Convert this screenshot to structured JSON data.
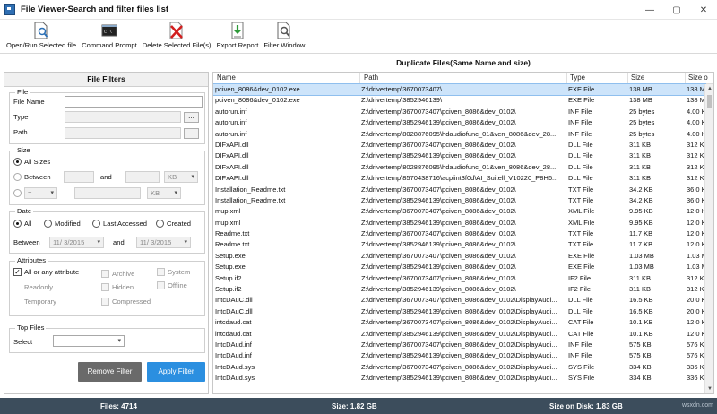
{
  "window": {
    "title": "File Viewer-Search and filter files list",
    "controls": [
      "—",
      "▢",
      "✕"
    ]
  },
  "toolbar": {
    "items": [
      {
        "label": "Open/Run Selected file",
        "icon": "open-file-icon"
      },
      {
        "label": "Command Prompt",
        "icon": "command-prompt-icon"
      },
      {
        "label": "Delete Selected File(s)",
        "icon": "delete-icon"
      },
      {
        "label": "Export Report",
        "icon": "export-icon"
      },
      {
        "label": "Filter Window",
        "icon": "filter-icon"
      }
    ]
  },
  "filters": {
    "header": "File Filters",
    "file": {
      "group_title": "File",
      "file_name_label": "File Name",
      "type_label": "Type",
      "path_label": "Path",
      "browse": "..."
    },
    "size": {
      "group_title": "Size",
      "all_sizes": "All Sizes",
      "between": "Between",
      "and": "and",
      "unit1": "KB",
      "operator": "=",
      "unit2": "KB"
    },
    "date": {
      "group_title": "Date",
      "all": "All",
      "modified": "Modified",
      "last_accessed": "Last Accessed",
      "created": "Created",
      "between": "Between",
      "from": "11/  3/2015",
      "and": "and",
      "to": "11/  3/2015"
    },
    "attributes": {
      "group_title": "Attributes",
      "all_or_any": "All or any attribute",
      "readonly": "Readonly",
      "temporary": "Temporary",
      "archive": "Archive",
      "hidden": "Hidden",
      "compressed": "Compressed",
      "system": "System",
      "offline": "Offline"
    },
    "top_files": {
      "group_title": "Top Files",
      "select_label": "Select",
      "select_value": ""
    },
    "remove_button": "Remove Filter",
    "apply_button": "Apply Filter"
  },
  "results": {
    "title": "Duplicate Files(Same Name and size)",
    "columns": [
      "Name",
      "Path",
      "Type",
      "Size",
      "Size o"
    ],
    "rows": [
      {
        "name": "pciven_8086&dev_0102.exe",
        "path": "Z:\\drivertemp\\3670073407\\",
        "type": "EXE File",
        "size": "138 MB",
        "disk": "138 M"
      },
      {
        "name": "pciven_8086&dev_0102.exe",
        "path": "Z:\\drivertemp\\3852946139\\",
        "type": "EXE File",
        "size": "138 MB",
        "disk": "138 M"
      },
      {
        "name": "autorun.inf",
        "path": "Z:\\drivertemp\\3670073407\\pciven_8086&dev_0102\\",
        "type": "INF File",
        "size": "25 bytes",
        "disk": "4.00 K"
      },
      {
        "name": "autorun.inf",
        "path": "Z:\\drivertemp\\3852946139\\pciven_8086&dev_0102\\",
        "type": "INF File",
        "size": "25 bytes",
        "disk": "4.00 K"
      },
      {
        "name": "autorun.inf",
        "path": "Z:\\drivertemp\\8028876095\\hdaudiofunc_01&ven_8086&dev_28...",
        "type": "INF File",
        "size": "25 bytes",
        "disk": "4.00 K"
      },
      {
        "name": "DIFxAPI.dll",
        "path": "Z:\\drivertemp\\3670073407\\pciven_8086&dev_0102\\",
        "type": "DLL File",
        "size": "311 KB",
        "disk": "312 K"
      },
      {
        "name": "DIFxAPI.dll",
        "path": "Z:\\drivertemp\\3852946139\\pciven_8086&dev_0102\\",
        "type": "DLL File",
        "size": "311 KB",
        "disk": "312 K"
      },
      {
        "name": "DIFxAPI.dll",
        "path": "Z:\\drivertemp\\8028876095\\hdaudiofunc_01&ven_8086&dev_28...",
        "type": "DLL File",
        "size": "311 KB",
        "disk": "312 K"
      },
      {
        "name": "DIFxAPI.dll",
        "path": "Z:\\drivertemp\\8570438716\\acpiint3f0d\\AI_Suitell_V10220_P8H6...",
        "type": "DLL File",
        "size": "311 KB",
        "disk": "312 K"
      },
      {
        "name": "Installation_Readme.txt",
        "path": "Z:\\drivertemp\\3670073407\\pciven_8086&dev_0102\\",
        "type": "TXT File",
        "size": "34.2 KB",
        "disk": "36.0 K"
      },
      {
        "name": "Installation_Readme.txt",
        "path": "Z:\\drivertemp\\3852946139\\pciven_8086&dev_0102\\",
        "type": "TXT File",
        "size": "34.2 KB",
        "disk": "36.0 K"
      },
      {
        "name": "mup.xml",
        "path": "Z:\\drivertemp\\3670073407\\pciven_8086&dev_0102\\",
        "type": "XML File",
        "size": "9.95 KB",
        "disk": "12.0 K"
      },
      {
        "name": "mup.xml",
        "path": "Z:\\drivertemp\\3852946139\\pciven_8086&dev_0102\\",
        "type": "XML File",
        "size": "9.95 KB",
        "disk": "12.0 K"
      },
      {
        "name": "Readme.txt",
        "path": "Z:\\drivertemp\\3670073407\\pciven_8086&dev_0102\\",
        "type": "TXT File",
        "size": "11.7 KB",
        "disk": "12.0 K"
      },
      {
        "name": "Readme.txt",
        "path": "Z:\\drivertemp\\3852946139\\pciven_8086&dev_0102\\",
        "type": "TXT File",
        "size": "11.7 KB",
        "disk": "12.0 K"
      },
      {
        "name": "Setup.exe",
        "path": "Z:\\drivertemp\\3670073407\\pciven_8086&dev_0102\\",
        "type": "EXE File",
        "size": "1.03 MB",
        "disk": "1.03 M"
      },
      {
        "name": "Setup.exe",
        "path": "Z:\\drivertemp\\3852946139\\pciven_8086&dev_0102\\",
        "type": "EXE File",
        "size": "1.03 MB",
        "disk": "1.03 M"
      },
      {
        "name": "Setup.if2",
        "path": "Z:\\drivertemp\\3670073407\\pciven_8086&dev_0102\\",
        "type": "IF2 File",
        "size": "311 KB",
        "disk": "312 K"
      },
      {
        "name": "Setup.if2",
        "path": "Z:\\drivertemp\\3852946139\\pciven_8086&dev_0102\\",
        "type": "IF2 File",
        "size": "311 KB",
        "disk": "312 K"
      },
      {
        "name": "IntcDAuC.dll",
        "path": "Z:\\drivertemp\\3670073407\\pciven_8086&dev_0102\\DisplayAudi...",
        "type": "DLL File",
        "size": "16.5 KB",
        "disk": "20.0 K"
      },
      {
        "name": "IntcDAuC.dll",
        "path": "Z:\\drivertemp\\3852946139\\pciven_8086&dev_0102\\DisplayAudi...",
        "type": "DLL File",
        "size": "16.5 KB",
        "disk": "20.0 K"
      },
      {
        "name": "intcdaud.cat",
        "path": "Z:\\drivertemp\\3670073407\\pciven_8086&dev_0102\\DisplayAudi...",
        "type": "CAT File",
        "size": "10.1 KB",
        "disk": "12.0 K"
      },
      {
        "name": "intcdaud.cat",
        "path": "Z:\\drivertemp\\3852946139\\pciven_8086&dev_0102\\DisplayAudi...",
        "type": "CAT File",
        "size": "10.1 KB",
        "disk": "12.0 K"
      },
      {
        "name": "IntcDAud.inf",
        "path": "Z:\\drivertemp\\3670073407\\pciven_8086&dev_0102\\DisplayAudi...",
        "type": "INF File",
        "size": "575 KB",
        "disk": "576 K"
      },
      {
        "name": "IntcDAud.inf",
        "path": "Z:\\drivertemp\\3852946139\\pciven_8086&dev_0102\\DisplayAudi...",
        "type": "INF File",
        "size": "575 KB",
        "disk": "576 K"
      },
      {
        "name": "IntcDAud.sys",
        "path": "Z:\\drivertemp\\3670073407\\pciven_8086&dev_0102\\DisplayAudi...",
        "type": "SYS File",
        "size": "334 KB",
        "disk": "336 K"
      },
      {
        "name": "IntcDAud.sys",
        "path": "Z:\\drivertemp\\3852946139\\pciven_8086&dev_0102\\DisplayAudi...",
        "type": "SYS File",
        "size": "334 KB",
        "disk": "336 K"
      }
    ]
  },
  "status": {
    "files": "Files: 4714",
    "size": "Size: 1.82 GB",
    "size_on_disk": "Size on Disk: 1.83 GB",
    "watermark": "wsxdn.com"
  },
  "colors": {
    "apply_button": "#2b8fe0",
    "remove_button": "#6a6a6a",
    "status_bar": "#3c4d5c",
    "selected_row": "#cde4fa"
  }
}
